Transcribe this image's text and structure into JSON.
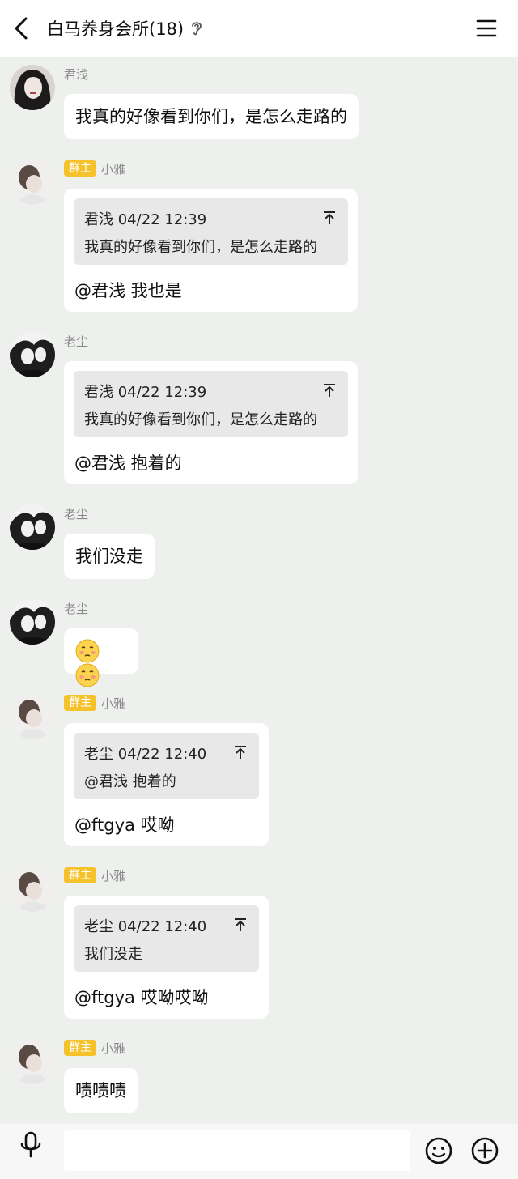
{
  "header": {
    "title": "白马养身会所(18)",
    "back_icon": "chevron-left-icon",
    "ear_icon": "ear-icon",
    "menu_icon": "hamburger-menu-icon"
  },
  "messages": [
    {
      "sender": "君浅",
      "badge": "",
      "text": "我真的好像看到你们，是怎么走路的"
    },
    {
      "sender": "小雅",
      "badge": "群主",
      "quote_meta": "君浅 04/22 12:39",
      "quote_text": "我真的好像看到你们，是怎么走路的",
      "text": "@君浅 我也是"
    },
    {
      "sender": "老尘",
      "badge": "",
      "quote_meta": "君浅 04/22 12:39",
      "quote_text": "我真的好像看到你们，是怎么走路的",
      "text": "@君浅 抱着的"
    },
    {
      "sender": "老尘",
      "badge": "",
      "text": "我们没走"
    },
    {
      "sender": "老尘",
      "badge": "",
      "emoji": [
        "blush-face-emoji",
        "blush-face-emoji"
      ]
    },
    {
      "sender": "小雅",
      "badge": "群主",
      "quote_meta": "老尘 04/22 12:40",
      "quote_text": "@君浅 抱着的",
      "text": "@ftgya 哎呦"
    },
    {
      "sender": "小雅",
      "badge": "群主",
      "quote_meta": "老尘 04/22 12:40",
      "quote_text": "我们没走",
      "text": "@ftgya 哎呦哎呦"
    },
    {
      "sender": "小雅",
      "badge": "群主",
      "text": "啧啧啧"
    }
  ],
  "bottom": {
    "mic_icon": "microphone-icon",
    "input_value": "",
    "emoji_icon": "smiley-icon",
    "plus_icon": "plus-circle-icon"
  },
  "colors": {
    "background": "#eef0ee",
    "bubble": "#ffffff",
    "quote": "#e8e8e8",
    "badge": "#f5c22b"
  }
}
